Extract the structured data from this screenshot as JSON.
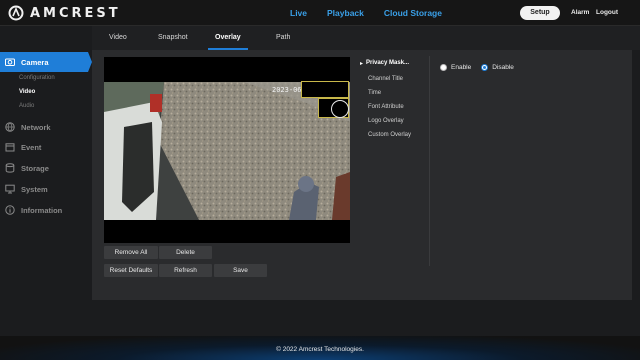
{
  "header": {
    "logo_text": "AMCREST",
    "nav": [
      "Live",
      "Playback",
      "Cloud Storage"
    ],
    "setup_label": "Setup",
    "alarm_label": "Alarm",
    "logout_label": "Logout",
    "accent_color": "#3aa0e8"
  },
  "sidebar": {
    "items": [
      {
        "label": "Camera",
        "icon": "camera-icon",
        "active": true
      },
      {
        "label": "Network",
        "icon": "globe-icon"
      },
      {
        "label": "Event",
        "icon": "calendar-icon"
      },
      {
        "label": "Storage",
        "icon": "database-icon"
      },
      {
        "label": "System",
        "icon": "monitor-icon"
      },
      {
        "label": "Information",
        "icon": "info-icon"
      }
    ],
    "sub_items": [
      "Configuration",
      "Video",
      "Audio"
    ],
    "active_sub": "Video",
    "active_color": "#1f7ed8"
  },
  "tabs": {
    "items": [
      "Video",
      "Snapshot",
      "Overlay",
      "Path"
    ],
    "active": "Overlay"
  },
  "video": {
    "timestamp": "2023-06-0"
  },
  "buttons": {
    "remove_all": "Remove All",
    "delete": "Delete",
    "reset_defaults": "Reset Defaults",
    "refresh": "Refresh",
    "save": "Save"
  },
  "overlay_list": {
    "items": [
      "Privacy Mask...",
      "Channel Title",
      "Time",
      "Font Attribute",
      "Logo Overlay",
      "Custom Overlay"
    ],
    "active": "Privacy Mask..."
  },
  "privacy_mask": {
    "enable_label": "Enable",
    "disable_label": "Disable",
    "selected": "Disable"
  },
  "footer": {
    "copyright": "© 2022 Amcrest Technologies."
  }
}
